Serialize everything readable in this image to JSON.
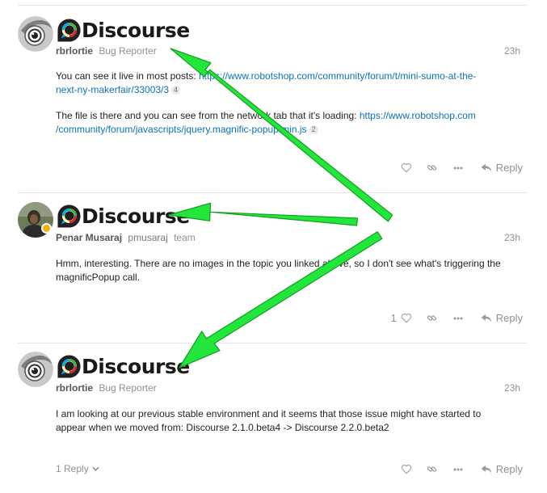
{
  "posts": [
    {
      "brand": "Discourse",
      "username": "rbrlortie",
      "user_title": "Bug Reporter",
      "time": "23h",
      "paragraphs": [
        {
          "before": "You can see it live in most posts: ",
          "link": "https://www.robotshop.com/community/forum/t/mini-sumo-at-the-next-ny-makerfair/33003/3",
          "link_display_1": "https://www.robotshop.com/community/forum/t/mini-sumo-at-the-",
          "link_display_2": "next-ny-makerfair/33003/3",
          "clicks": "4"
        },
        {
          "before": "The file is there and you can see from the network tab that it's loading: ",
          "link": "https://www.robotshop.com/community/forum/javascripts/jquery.magnific-popup.min.js",
          "link_display_1": "https://www.robotshop.com",
          "link_display_2": "/community/forum/javascripts/jquery.magnific-popup.min.js",
          "clicks": "2"
        }
      ],
      "reply_label": "Reply"
    },
    {
      "brand": "Discourse",
      "full_name": "Penar Musaraj",
      "username": "pmusaraj",
      "group": "team",
      "time": "23h",
      "text": "Hmm, interesting. There are no images in the topic you linked above, so I don't see what's triggering the magnificPopup call.",
      "like_count": "1",
      "reply_label": "Reply"
    },
    {
      "brand": "Discourse",
      "username": "rbrlortie",
      "user_title": "Bug Reporter",
      "time": "23h",
      "text": "I am looking at our previous stable environment and it seems that those issue might have started to appear when we moved from: Discourse 2.1.0.beta4 -> Discourse 2.2.0.beta2",
      "replies_label": "1 Reply",
      "reply_label": "Reply"
    }
  ],
  "colors": {
    "link": "#0a72ba",
    "muted": "#919191",
    "arrow": "#22e639",
    "logo_ring_outer": "#00aeef",
    "logo_ring_green": "#3ab54a",
    "logo_ring_red": "#d0232b",
    "logo_ring_yellow": "#fff9ae"
  },
  "icons": [
    "avatar-eye-icon",
    "discourse-logo-icon",
    "heart-icon",
    "link-icon",
    "more-icon",
    "reply-icon",
    "chevron-down-icon"
  ]
}
